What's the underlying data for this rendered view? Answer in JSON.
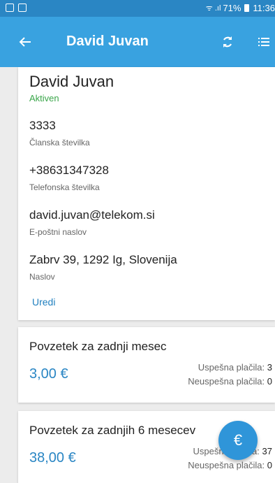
{
  "status_bar": {
    "battery": "71%",
    "time": "11:36"
  },
  "app_bar": {
    "title": "David Juvan",
    "back_icon": "arrow-back-icon",
    "refresh_icon": "refresh-icon",
    "menu_icon": "list-menu-icon"
  },
  "profile": {
    "name": "David Juvan",
    "status": "Aktiven",
    "member_number": "3333",
    "member_number_label": "Članska številka",
    "phone": "+38631347328",
    "phone_label": "Telefonska številka",
    "email": "david.juvan@telekom.si",
    "email_label": "E-poštni naslov",
    "address": "Zabrv 39, 1292 Ig, Slovenija",
    "address_label": "Naslov",
    "edit_label": "Uredi"
  },
  "summary_month": {
    "title": "Povzetek za zadnji mesec",
    "amount": "3,00 €",
    "success_label": "Uspešna plačila:",
    "success_count": "3",
    "fail_label": "Neuspešna plačila:",
    "fail_count": "0"
  },
  "summary_six": {
    "title": "Povzetek za zadnjih 6 mesecev",
    "amount": "38,00 €",
    "success_label": "Uspešna plačila:",
    "success_count": "37",
    "fail_label": "Neuspešna plačila:",
    "fail_count": "0"
  },
  "fab": {
    "icon": "euro-icon",
    "glyph": "€"
  },
  "colors": {
    "app_bar": "#39a2e0",
    "status_bar": "#2a86c4",
    "active": "#3aa64a",
    "amount": "#2a86c4"
  }
}
